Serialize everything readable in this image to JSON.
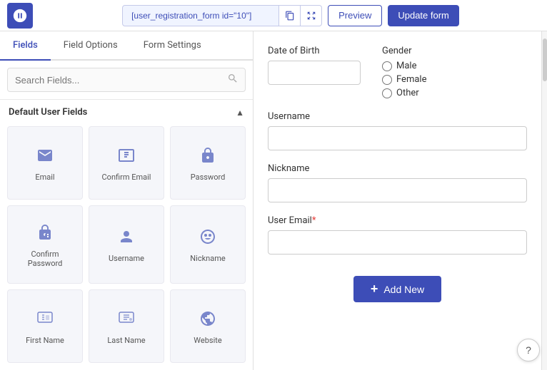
{
  "header": {
    "shortcode": "[user_registration_form id=\"10\"]",
    "preview_label": "Preview",
    "update_label": "Update form"
  },
  "tabs": [
    {
      "label": "Fields",
      "active": true
    },
    {
      "label": "Field Options",
      "active": false
    },
    {
      "label": "Form Settings",
      "active": false
    }
  ],
  "search": {
    "placeholder": "Search Fields..."
  },
  "section": {
    "label": "Default User Fields"
  },
  "fields": [
    {
      "id": "email",
      "label": "Email",
      "icon": "✉"
    },
    {
      "id": "confirm-email",
      "label": "Confirm Email",
      "icon": "🖼"
    },
    {
      "id": "password",
      "label": "Password",
      "icon": "🛍"
    },
    {
      "id": "confirm-password",
      "label": "Confirm Password",
      "icon": "🔓"
    },
    {
      "id": "username",
      "label": "Username",
      "icon": "👤"
    },
    {
      "id": "nickname",
      "label": "Nickname",
      "icon": "😐"
    },
    {
      "id": "first-name",
      "label": "First Name",
      "icon": "🪪"
    },
    {
      "id": "last-name",
      "label": "Last Name",
      "icon": "🪪"
    },
    {
      "id": "website",
      "label": "Website",
      "icon": "🌐"
    }
  ],
  "form_preview": {
    "date_of_birth_label": "Date of Birth",
    "gender_label": "Gender",
    "gender_options": [
      "Male",
      "Female",
      "Other"
    ],
    "username_label": "Username",
    "nickname_label": "Nickname",
    "user_email_label": "User Email",
    "user_email_required": "*"
  },
  "add_new_label": "Add New",
  "help_label": "?"
}
